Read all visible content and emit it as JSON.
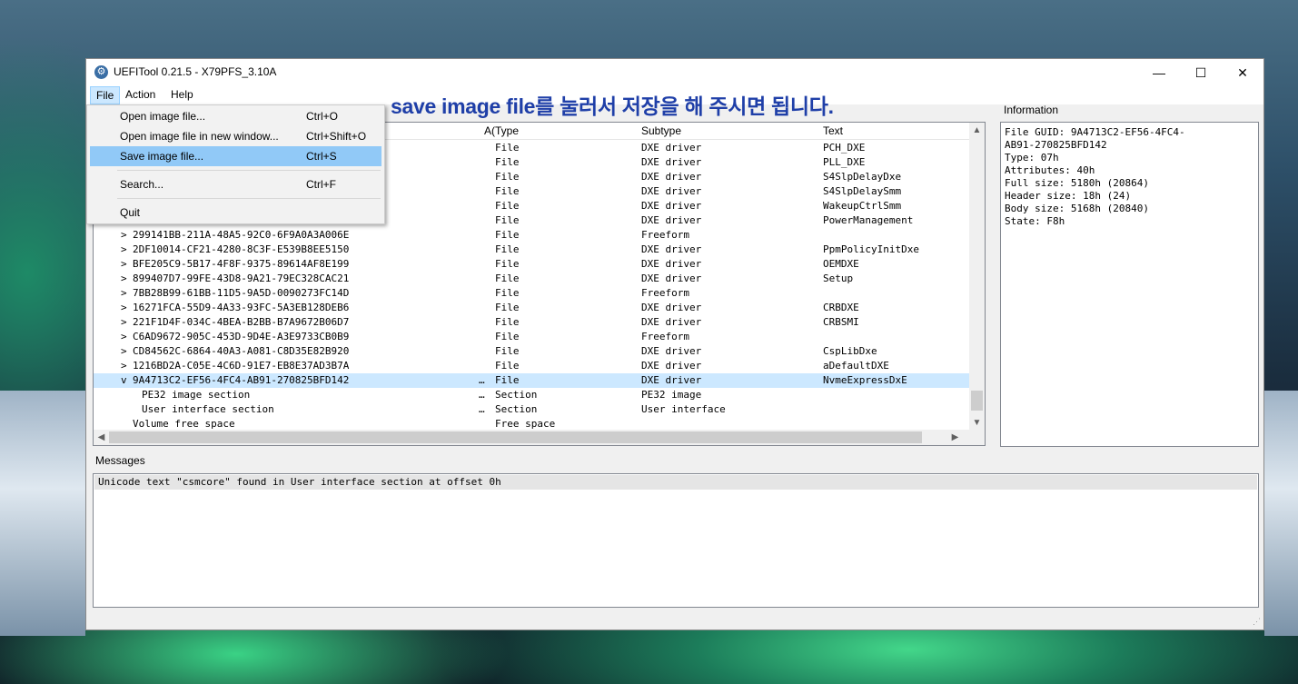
{
  "window": {
    "title": "UEFITool 0.21.5 - X79PFS_3.10A",
    "app_icon": "gear-icon",
    "minimize_glyph": "—",
    "maximize_glyph": "☐",
    "close_glyph": "✕"
  },
  "menu": {
    "file": "File",
    "action": "Action",
    "help": "Help"
  },
  "file_menu": {
    "items": [
      {
        "label": "Open image file...",
        "shortcut": "Ctrl+O"
      },
      {
        "label": "Open image file in new window...",
        "shortcut": "Ctrl+Shift+O"
      },
      {
        "label": "Save image file...",
        "shortcut": "Ctrl+S"
      },
      {
        "label": "Search...",
        "shortcut": "Ctrl+F"
      },
      {
        "label": "Quit",
        "shortcut": ""
      }
    ]
  },
  "annotation": "save image file를 눌러서 저장을 해 주시면 됩니다.",
  "tree": {
    "headers": {
      "action": "A(",
      "type": "Type",
      "subtype": "Subtype",
      "text": "Text"
    },
    "rows": [
      {
        "expander": "",
        "name": "",
        "action": "",
        "type": "File",
        "subtype": "DXE driver",
        "text": "PCH_DXE"
      },
      {
        "expander": "",
        "name": "",
        "action": "",
        "type": "File",
        "subtype": "DXE driver",
        "text": "PLL_DXE"
      },
      {
        "expander": "",
        "name": "",
        "action": "",
        "type": "File",
        "subtype": "DXE driver",
        "text": "S4SlpDelayDxe"
      },
      {
        "expander": "",
        "name": "",
        "action": "",
        "type": "File",
        "subtype": "DXE driver",
        "text": "S4SlpDelaySmm"
      },
      {
        "expander": "",
        "name": "",
        "action": "",
        "type": "File",
        "subtype": "DXE driver",
        "text": "WakeupCtrlSmm"
      },
      {
        "expander": "",
        "name": "",
        "action": "",
        "type": "File",
        "subtype": "DXE driver",
        "text": "PowerManagement"
      },
      {
        "expander": ">",
        "name": "299141BB-211A-48A5-92C0-6F9A0A3A006E",
        "action": "",
        "type": "File",
        "subtype": "Freeform",
        "text": ""
      },
      {
        "expander": ">",
        "name": "2DF10014-CF21-4280-8C3F-E539B8EE5150",
        "action": "",
        "type": "File",
        "subtype": "DXE driver",
        "text": "PpmPolicyInitDxe"
      },
      {
        "expander": ">",
        "name": "BFE205C9-5B17-4F8F-9375-89614AF8E199",
        "action": "",
        "type": "File",
        "subtype": "DXE driver",
        "text": "OEMDXE"
      },
      {
        "expander": ">",
        "name": "899407D7-99FE-43D8-9A21-79EC328CAC21",
        "action": "",
        "type": "File",
        "subtype": "DXE driver",
        "text": "Setup"
      },
      {
        "expander": ">",
        "name": "7BB28B99-61BB-11D5-9A5D-0090273FC14D",
        "action": "",
        "type": "File",
        "subtype": "Freeform",
        "text": ""
      },
      {
        "expander": ">",
        "name": "16271FCA-55D9-4A33-93FC-5A3EB128DEB6",
        "action": "",
        "type": "File",
        "subtype": "DXE driver",
        "text": "CRBDXE"
      },
      {
        "expander": ">",
        "name": "221F1D4F-034C-4BEA-B2BB-B7A9672B06D7",
        "action": "",
        "type": "File",
        "subtype": "DXE driver",
        "text": "CRBSMI"
      },
      {
        "expander": ">",
        "name": "C6AD9672-905C-453D-9D4E-A3E9733CB0B9",
        "action": "",
        "type": "File",
        "subtype": "Freeform",
        "text": ""
      },
      {
        "expander": ">",
        "name": "CD84562C-6864-40A3-A081-C8D35E82B920",
        "action": "",
        "type": "File",
        "subtype": "DXE driver",
        "text": "CspLibDxe"
      },
      {
        "expander": ">",
        "name": "1216BD2A-C05E-4C6D-91E7-EB8E37AD3B7A",
        "action": "",
        "type": "File",
        "subtype": "DXE driver",
        "text": "aDefaultDXE"
      },
      {
        "expander": "v",
        "name": "9A4713C2-EF56-4FC4-AB91-270825BFD142",
        "action": "…",
        "type": "File",
        "subtype": "DXE driver",
        "text": "NvmeExpressDxE"
      },
      {
        "expander": "",
        "name": "PE32 image section",
        "action": "…",
        "type": "Section",
        "subtype": "PE32 image",
        "text": ""
      },
      {
        "expander": "",
        "name": "User interface section",
        "action": "…",
        "type": "Section",
        "subtype": "User interface",
        "text": ""
      },
      {
        "expander": "",
        "name": "Volume free space",
        "action": "",
        "type": "Free space",
        "subtype": "",
        "text": ""
      }
    ]
  },
  "information": {
    "label": "Information",
    "lines": [
      "File GUID: 9A4713C2-EF56-4FC4-",
      "AB91-270825BFD142",
      "Type: 07h",
      "Attributes: 40h",
      "Full size: 5180h (20864)",
      "Header size: 18h (24)",
      "Body size: 5168h (20840)",
      "State: F8h"
    ]
  },
  "messages": {
    "label": "Messages",
    "lines": [
      "Unicode text \"csmcore\" found in User interface section at offset 0h"
    ]
  }
}
